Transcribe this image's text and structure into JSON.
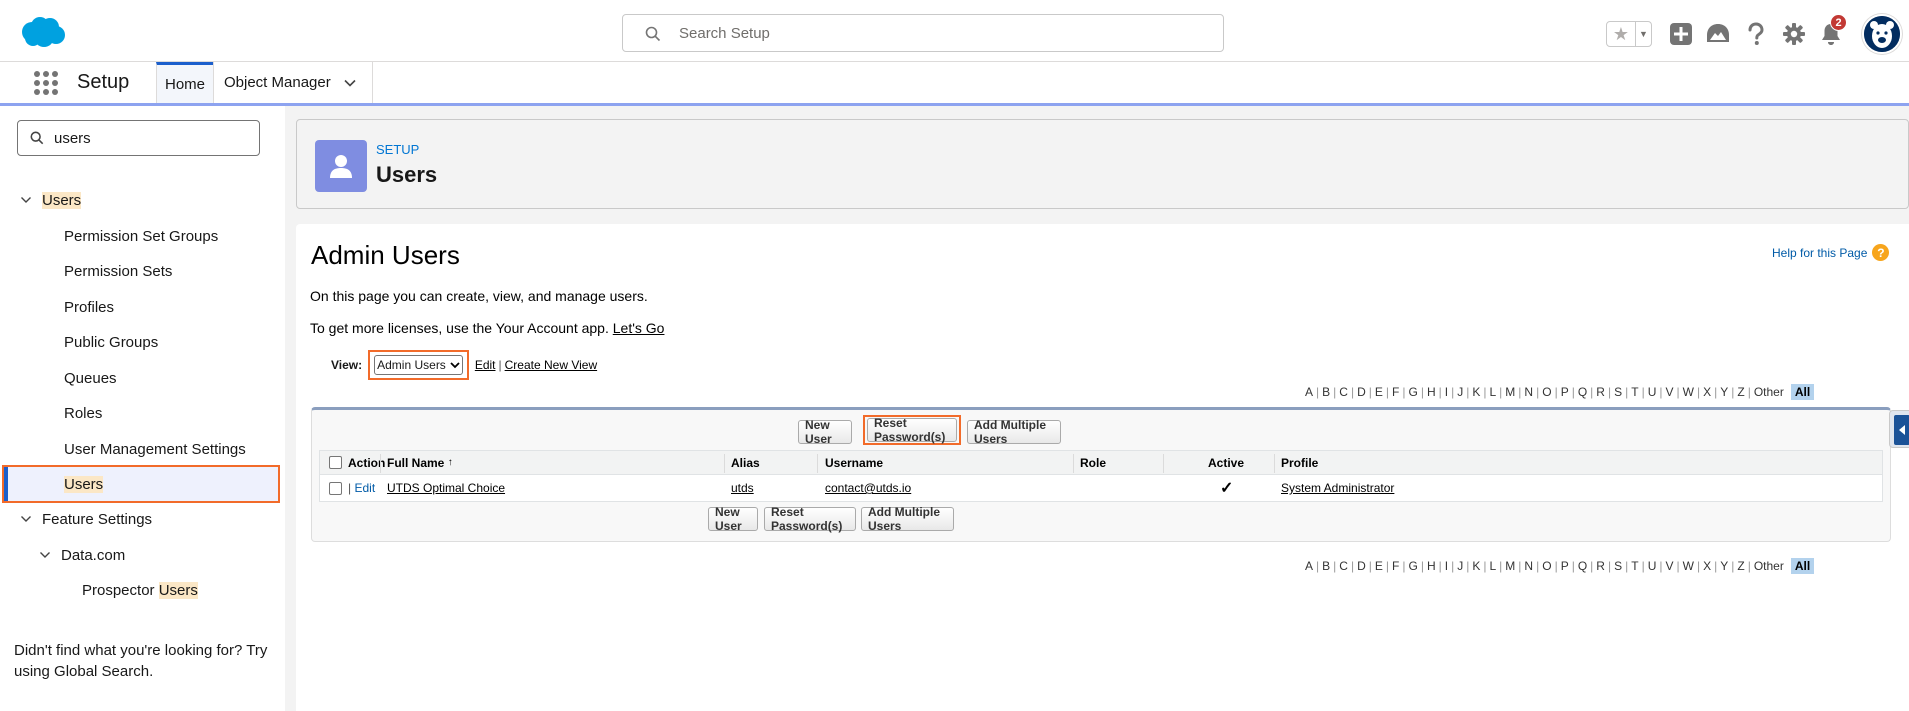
{
  "header": {
    "search_placeholder": "Search Setup",
    "notification_count": "2"
  },
  "nav": {
    "app_name": "Setup",
    "tabs": [
      {
        "label": "Home"
      },
      {
        "label": "Object Manager"
      }
    ]
  },
  "sidebar": {
    "search_value": "users",
    "tree": {
      "users": {
        "label": "Users"
      },
      "children": [
        {
          "label": "Permission Set Groups"
        },
        {
          "label": "Permission Sets"
        },
        {
          "label": "Profiles"
        },
        {
          "label": "Public Groups"
        },
        {
          "label": "Queues"
        },
        {
          "label": "Roles"
        },
        {
          "label": "User Management Settings"
        },
        {
          "label": "Users"
        }
      ],
      "feature_settings": {
        "label": "Feature Settings"
      },
      "datacom": {
        "label": "Data.com"
      },
      "prospector": {
        "prefix": "Prospector ",
        "highlight": "Users"
      }
    },
    "footer": "Didn't find what you're looking for? Try using Global Search."
  },
  "page_header": {
    "eyebrow": "SETUP",
    "title": "Users"
  },
  "content": {
    "title": "Admin Users",
    "help_link": "Help for this Page",
    "desc1": "On this page you can create, view, and manage users.",
    "desc2_text": "To get more licenses, use the Your Account app. ",
    "desc2_link": "Let's Go",
    "view_label": "View:",
    "view_selected": "Admin Users",
    "view_edit": "Edit",
    "view_sep": "|",
    "view_create": "Create New View",
    "alphabet": [
      "A",
      "B",
      "C",
      "D",
      "E",
      "F",
      "G",
      "H",
      "I",
      "J",
      "K",
      "L",
      "M",
      "N",
      "O",
      "P",
      "Q",
      "R",
      "S",
      "T",
      "U",
      "V",
      "W",
      "X",
      "Y",
      "Z",
      "Other"
    ],
    "alphabet_all": "All",
    "buttons": {
      "new_user": "New User",
      "reset_password": "Reset Password(s)",
      "add_multiple": "Add Multiple Users"
    },
    "table": {
      "columns": {
        "action": "Action",
        "full_name": "Full Name",
        "sort_arrow": "↑",
        "alias": "Alias",
        "username": "Username",
        "role": "Role",
        "active": "Active",
        "profile": "Profile"
      },
      "rows": [
        {
          "action_sep": "|",
          "action_edit": "Edit",
          "full_name": "UTDS Optimal Choice",
          "alias": "utds",
          "username": "contact@utds.io",
          "role": "",
          "active": "✓",
          "profile": "System Administrator"
        }
      ]
    }
  },
  "colors": {
    "brand_blue": "#0176d3",
    "highlight_orange": "#f26b2a",
    "badge_red": "#c23934",
    "users_icon_bg": "#7f8de1"
  }
}
